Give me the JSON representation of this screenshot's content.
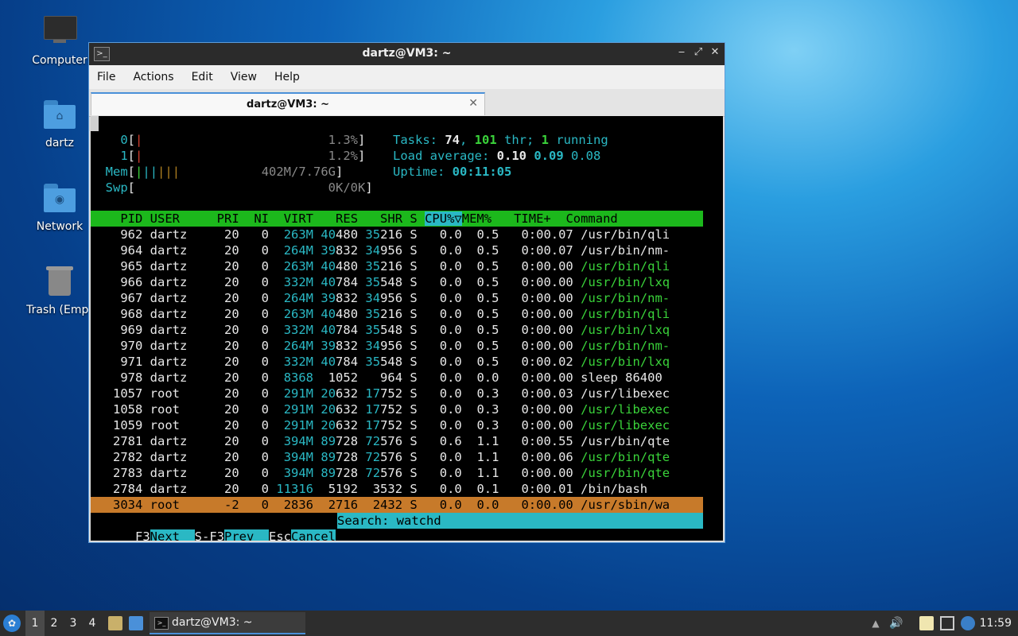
{
  "desktop": {
    "icons": [
      {
        "label": "Computer"
      },
      {
        "label": "dartz"
      },
      {
        "label": "Network"
      },
      {
        "label": "Trash (Empt"
      }
    ]
  },
  "window": {
    "title": "dartz@VM3: ~",
    "menu": [
      "File",
      "Actions",
      "Edit",
      "View",
      "Help"
    ],
    "tab_title": "dartz@VM3: ~",
    "controls": {
      "minimize": "‒",
      "maximize": "⤢",
      "close": "✕"
    }
  },
  "htop": {
    "cpu0": {
      "label": "0",
      "value": "1.3%"
    },
    "cpu1": {
      "label": "1",
      "value": "1.2%"
    },
    "mem": {
      "label": "Mem",
      "value": "402M/7.76G"
    },
    "swp": {
      "label": "Swp",
      "value": "0K/0K"
    },
    "tasks_label": "Tasks: ",
    "tasks": "74",
    "threads": "101",
    "thr_label": " thr; ",
    "running": "1",
    "running_label": " running",
    "load_label": "Load average: ",
    "load1": "0.10",
    "load5": "0.09",
    "load15": "0.08",
    "uptime_label": "Uptime: ",
    "uptime": "00:11:05",
    "header": {
      "pid": "PID",
      "user": "USER",
      "pri": "PRI",
      "ni": "NI",
      "virt": "VIRT",
      "res": "RES",
      "shr": "SHR",
      "s": "S",
      "cpu": "CPU%▽",
      "mem": "MEM%",
      "time": "TIME+",
      "cmd": "Command"
    },
    "rows": [
      {
        "pid": "962",
        "user": "dartz",
        "pri": "20",
        "ni": "0",
        "virt": "263M",
        "res": "40480",
        "shr": "35216",
        "s": "S",
        "cpu": "0.0",
        "mem": "0.5",
        "time": "0:00.07",
        "cmd": "/usr/bin/qli",
        "thread": false
      },
      {
        "pid": "964",
        "user": "dartz",
        "pri": "20",
        "ni": "0",
        "virt": "264M",
        "res": "39832",
        "shr": "34956",
        "s": "S",
        "cpu": "0.0",
        "mem": "0.5",
        "time": "0:00.07",
        "cmd": "/usr/bin/nm-",
        "thread": false
      },
      {
        "pid": "965",
        "user": "dartz",
        "pri": "20",
        "ni": "0",
        "virt": "263M",
        "res": "40480",
        "shr": "35216",
        "s": "S",
        "cpu": "0.0",
        "mem": "0.5",
        "time": "0:00.00",
        "cmd": "/usr/bin/qli",
        "thread": true
      },
      {
        "pid": "966",
        "user": "dartz",
        "pri": "20",
        "ni": "0",
        "virt": "332M",
        "res": "40784",
        "shr": "35548",
        "s": "S",
        "cpu": "0.0",
        "mem": "0.5",
        "time": "0:00.00",
        "cmd": "/usr/bin/lxq",
        "thread": true
      },
      {
        "pid": "967",
        "user": "dartz",
        "pri": "20",
        "ni": "0",
        "virt": "264M",
        "res": "39832",
        "shr": "34956",
        "s": "S",
        "cpu": "0.0",
        "mem": "0.5",
        "time": "0:00.00",
        "cmd": "/usr/bin/nm-",
        "thread": true
      },
      {
        "pid": "968",
        "user": "dartz",
        "pri": "20",
        "ni": "0",
        "virt": "263M",
        "res": "40480",
        "shr": "35216",
        "s": "S",
        "cpu": "0.0",
        "mem": "0.5",
        "time": "0:00.00",
        "cmd": "/usr/bin/qli",
        "thread": true
      },
      {
        "pid": "969",
        "user": "dartz",
        "pri": "20",
        "ni": "0",
        "virt": "332M",
        "res": "40784",
        "shr": "35548",
        "s": "S",
        "cpu": "0.0",
        "mem": "0.5",
        "time": "0:00.00",
        "cmd": "/usr/bin/lxq",
        "thread": true
      },
      {
        "pid": "970",
        "user": "dartz",
        "pri": "20",
        "ni": "0",
        "virt": "264M",
        "res": "39832",
        "shr": "34956",
        "s": "S",
        "cpu": "0.0",
        "mem": "0.5",
        "time": "0:00.00",
        "cmd": "/usr/bin/nm-",
        "thread": true
      },
      {
        "pid": "971",
        "user": "dartz",
        "pri": "20",
        "ni": "0",
        "virt": "332M",
        "res": "40784",
        "shr": "35548",
        "s": "S",
        "cpu": "0.0",
        "mem": "0.5",
        "time": "0:00.02",
        "cmd": "/usr/bin/lxq",
        "thread": true
      },
      {
        "pid": "978",
        "user": "dartz",
        "pri": "20",
        "ni": "0",
        "virt": "8368",
        "res": "1052",
        "shr": "964",
        "s": "S",
        "cpu": "0.0",
        "mem": "0.0",
        "time": "0:00.00",
        "cmd": "sleep 86400",
        "thread": false
      },
      {
        "pid": "1057",
        "user": "root",
        "pri": "20",
        "ni": "0",
        "virt": "291M",
        "res": "20632",
        "shr": "17752",
        "s": "S",
        "cpu": "0.0",
        "mem": "0.3",
        "time": "0:00.03",
        "cmd": "/usr/libexec",
        "thread": false
      },
      {
        "pid": "1058",
        "user": "root",
        "pri": "20",
        "ni": "0",
        "virt": "291M",
        "res": "20632",
        "shr": "17752",
        "s": "S",
        "cpu": "0.0",
        "mem": "0.3",
        "time": "0:00.00",
        "cmd": "/usr/libexec",
        "thread": true
      },
      {
        "pid": "1059",
        "user": "root",
        "pri": "20",
        "ni": "0",
        "virt": "291M",
        "res": "20632",
        "shr": "17752",
        "s": "S",
        "cpu": "0.0",
        "mem": "0.3",
        "time": "0:00.00",
        "cmd": "/usr/libexec",
        "thread": true
      },
      {
        "pid": "2781",
        "user": "dartz",
        "pri": "20",
        "ni": "0",
        "virt": "394M",
        "res": "89728",
        "shr": "72576",
        "s": "S",
        "cpu": "0.6",
        "mem": "1.1",
        "time": "0:00.55",
        "cmd": "/usr/bin/qte",
        "thread": false
      },
      {
        "pid": "2782",
        "user": "dartz",
        "pri": "20",
        "ni": "0",
        "virt": "394M",
        "res": "89728",
        "shr": "72576",
        "s": "S",
        "cpu": "0.0",
        "mem": "1.1",
        "time": "0:00.06",
        "cmd": "/usr/bin/qte",
        "thread": true
      },
      {
        "pid": "2783",
        "user": "dartz",
        "pri": "20",
        "ni": "0",
        "virt": "394M",
        "res": "89728",
        "shr": "72576",
        "s": "S",
        "cpu": "0.0",
        "mem": "1.1",
        "time": "0:00.00",
        "cmd": "/usr/bin/qte",
        "thread": true
      },
      {
        "pid": "2784",
        "user": "dartz",
        "pri": "20",
        "ni": "0",
        "virt": "11316",
        "res": "5192",
        "shr": "3532",
        "s": "S",
        "cpu": "0.0",
        "mem": "0.1",
        "time": "0:00.01",
        "cmd": "/bin/bash",
        "thread": false
      },
      {
        "pid": "3034",
        "user": "root",
        "pri": "-2",
        "ni": "0",
        "virt": "2836",
        "res": "2716",
        "shr": "2432",
        "s": "S",
        "cpu": "0.0",
        "mem": "0.0",
        "time": "0:00.00",
        "cmd": "/usr/sbin/wa",
        "thread": false,
        "selected": true
      }
    ],
    "footer": {
      "f3_key": "F3",
      "f3_label": "Next",
      "sf3_key": "S-F3",
      "sf3_label": "Prev",
      "esc_key": "Esc",
      "esc_label": "Cancel",
      "search": "Search: watchd"
    }
  },
  "taskbar": {
    "workspaces": [
      "1",
      "2",
      "3",
      "4"
    ],
    "task_title": "dartz@VM3: ~",
    "clock": "11:59"
  }
}
